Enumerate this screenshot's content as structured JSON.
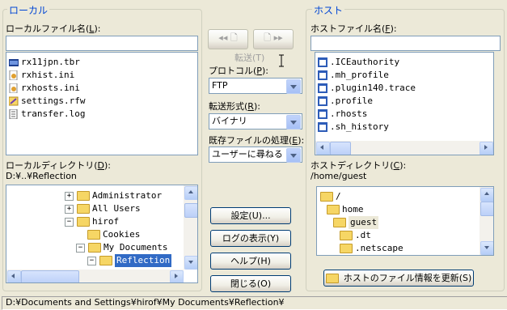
{
  "local": {
    "group_title": "ローカル",
    "file_label": "ローカルファイル名(",
    "file_label_key": "L",
    "file_label_end": "):",
    "filename_value": "",
    "files": [
      {
        "name": "rx11jpn.tbr",
        "icon": "toolbar-file-icon"
      },
      {
        "name": "rxhist.ini",
        "icon": "ini-file-icon"
      },
      {
        "name": "rxhosts.ini",
        "icon": "ini-file-icon"
      },
      {
        "name": "settings.rfw",
        "icon": "reflection-file-icon"
      },
      {
        "name": "transfer.log",
        "icon": "text-file-icon"
      }
    ],
    "dir_label": "ローカルディレクトリ(",
    "dir_label_key": "D",
    "dir_label_end": "):",
    "dir_path": "D:¥..¥Reflection",
    "tree": [
      {
        "name": "Administrator",
        "expander": "+"
      },
      {
        "name": "All Users",
        "expander": "+"
      },
      {
        "name": "hirof",
        "expander": "−"
      },
      {
        "name": "Cookies",
        "expander": ""
      },
      {
        "name": "My Documents",
        "expander": "−"
      },
      {
        "name": "Reflection",
        "expander": "−",
        "selected": true
      }
    ]
  },
  "center": {
    "transfer_left": "◂◂ 🗋",
    "transfer_right": "🗋 ▸▸",
    "transfer_label": "転送(T)",
    "protocol_label": "プロトコル(",
    "protocol_key": "P",
    "protocol_end": "):",
    "protocol_value": "FTP",
    "mode_label": "転送形式(",
    "mode_key": "R",
    "mode_end": "):",
    "mode_value": "バイナリ",
    "existing_label": "既存ファイルの処理(",
    "existing_key": "E",
    "existing_end": "):",
    "existing_value": "ユーザーに尋ねる",
    "settings_button": "設定(U)...",
    "log_button": "ログの表示(Y)",
    "help_button": "ヘルプ(H)",
    "close_button": "閉じる(O)"
  },
  "host": {
    "group_title": "ホスト",
    "file_label": "ホストファイル名(",
    "file_label_key": "F",
    "file_label_end": "):",
    "filename_value": "",
    "files": [
      {
        "name": ".ICEauthority"
      },
      {
        "name": ".mh_profile"
      },
      {
        "name": ".plugin140.trace"
      },
      {
        "name": ".profile"
      },
      {
        "name": ".rhosts"
      },
      {
        "name": ".sh_history"
      }
    ],
    "dir_label": "ホストディレクトリ(",
    "dir_label_key": "C",
    "dir_label_end": "):",
    "dir_path": "/home/guest",
    "tree": [
      {
        "name": "/"
      },
      {
        "name": "home"
      },
      {
        "name": "guest",
        "highlight": true
      },
      {
        "name": ".dt"
      },
      {
        "name": ".netscape"
      }
    ],
    "refresh_button": "ホストのファイル情報を更新(S)"
  },
  "status_text": "D:¥Documents and Settings¥hirof¥My Documents¥Reflection¥",
  "colors": {
    "group_title": "#0046d5",
    "selection": "#316ac5",
    "dialog_bg": "#ece9d8"
  }
}
